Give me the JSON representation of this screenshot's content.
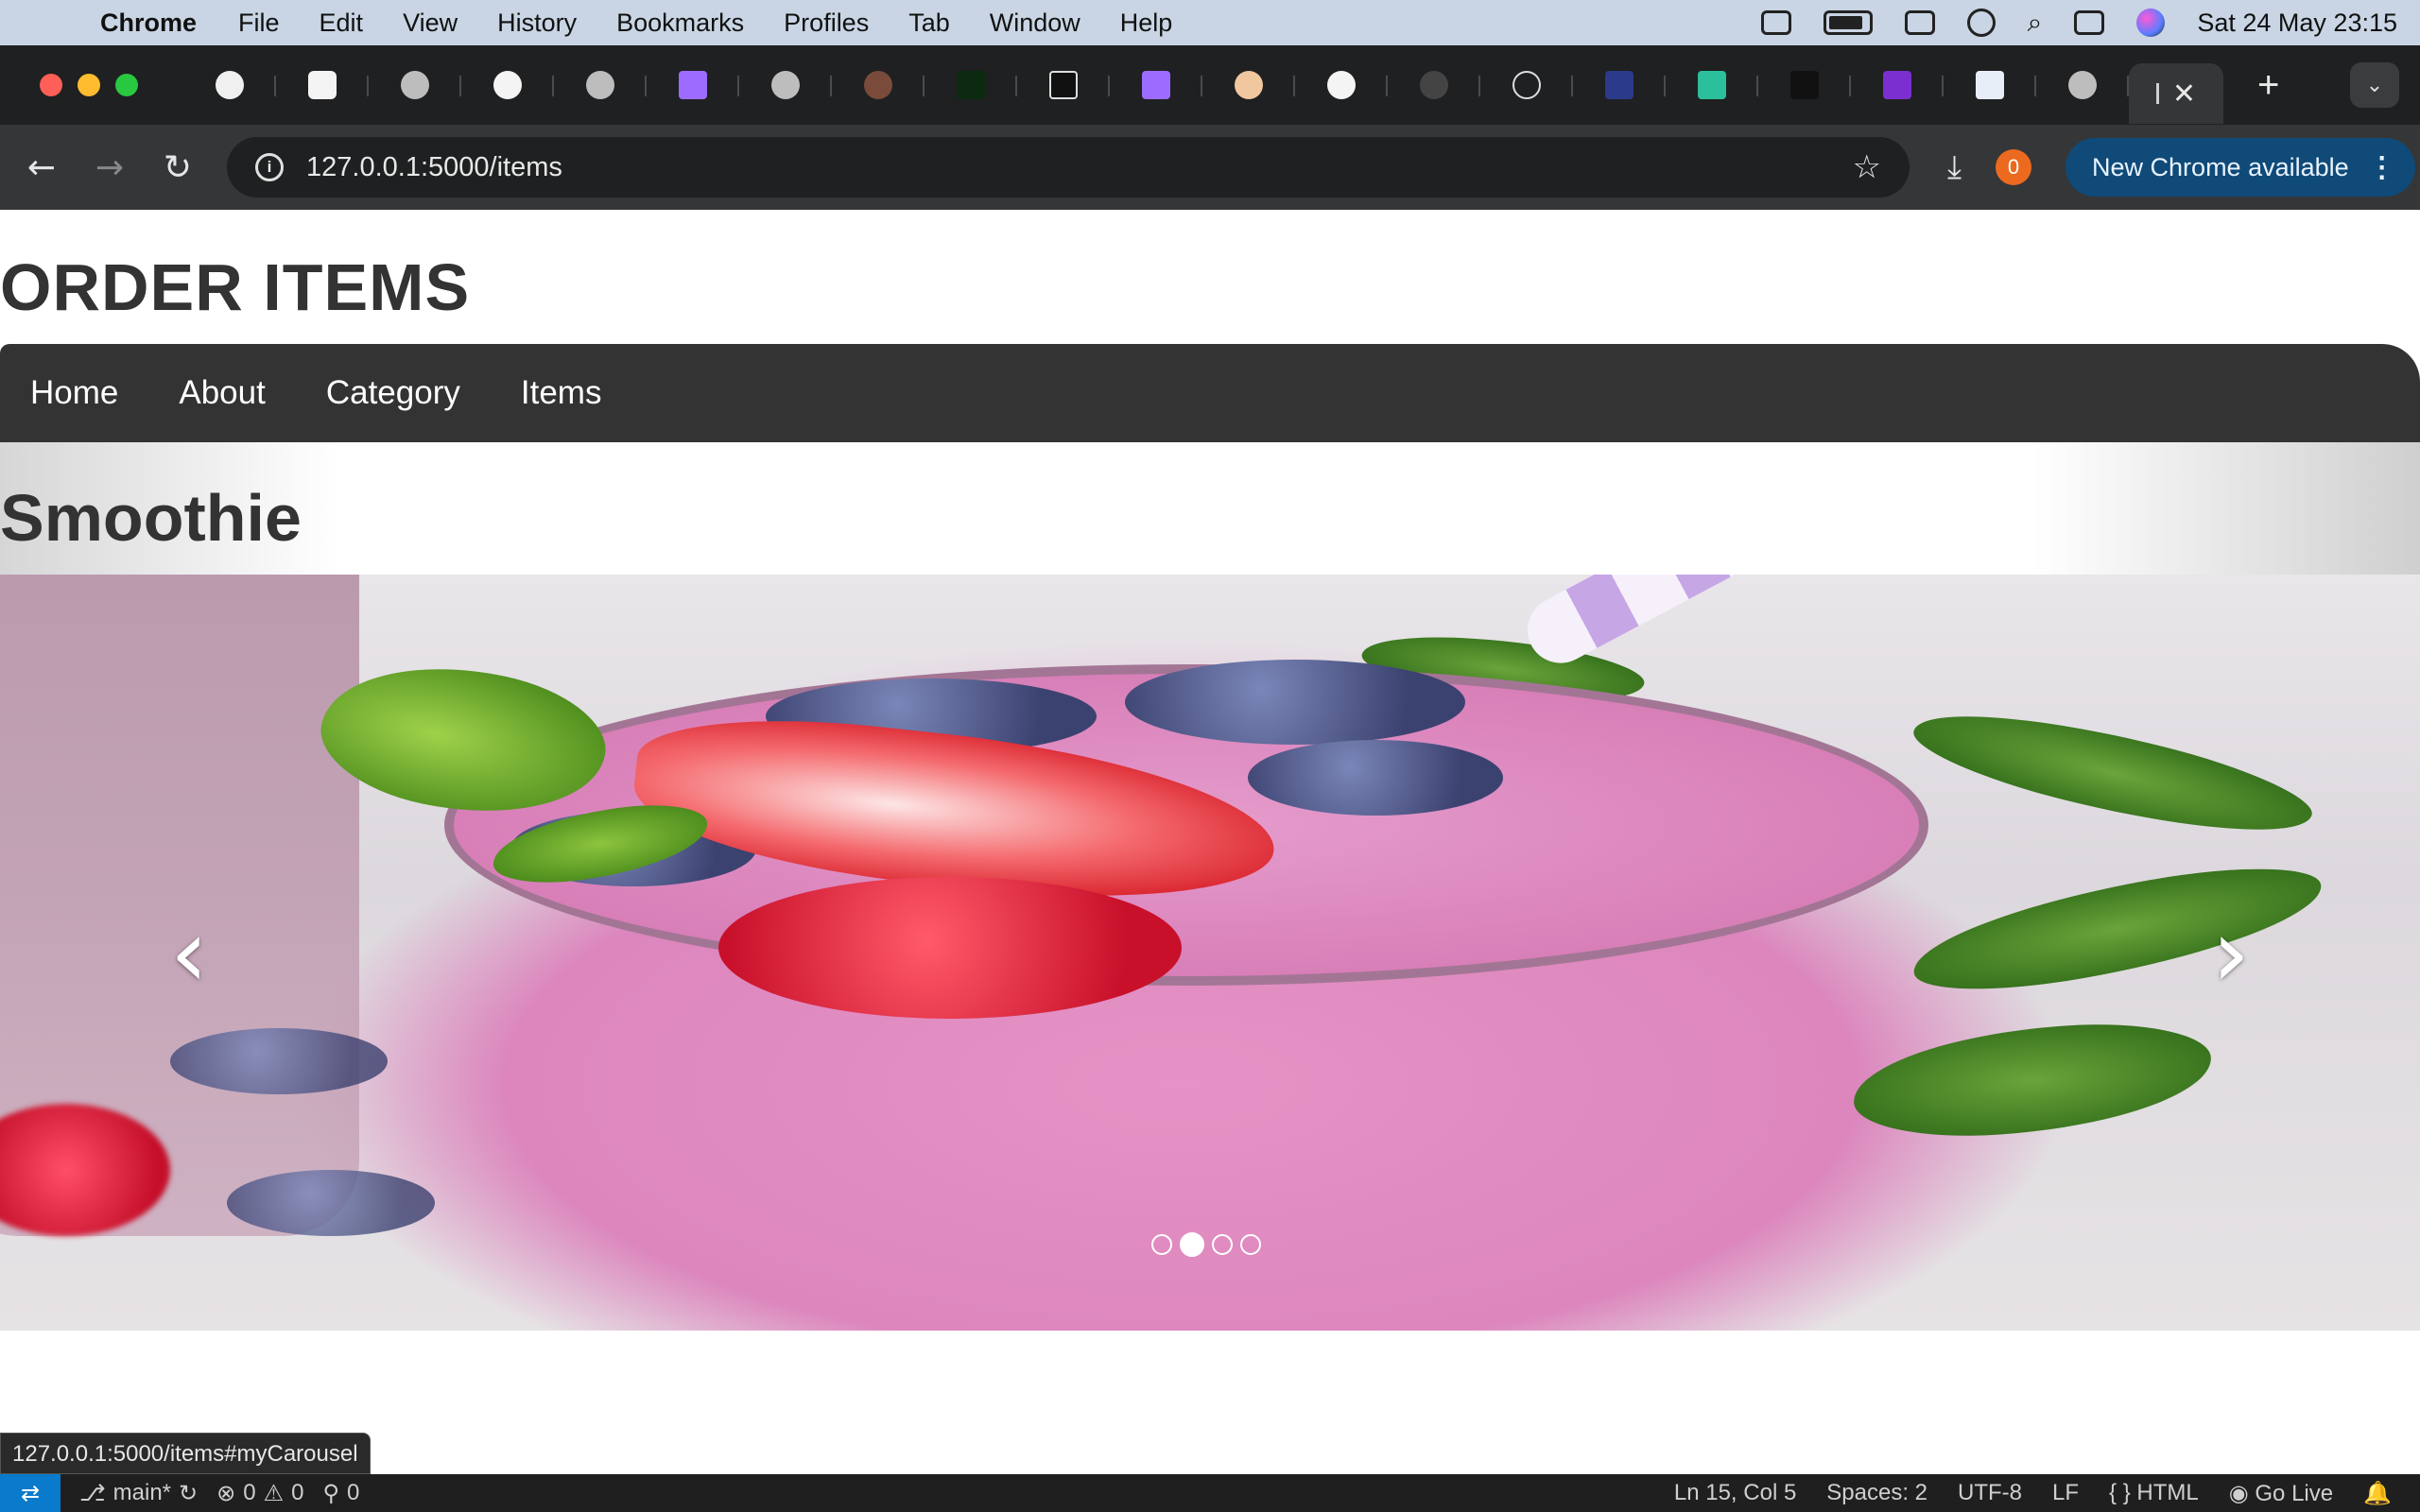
{
  "menubar": {
    "app_name": "Chrome",
    "items": [
      "File",
      "Edit",
      "View",
      "History",
      "Bookmarks",
      "Profiles",
      "Tab",
      "Window",
      "Help"
    ],
    "clock": "Sat 24 May  23:15"
  },
  "browser": {
    "url": "127.0.0.1:5000/items",
    "extension_badge": "0",
    "update_label": "New Chrome available",
    "tab_count_visible": 21
  },
  "site": {
    "title": "ORDER ITEMS",
    "nav": [
      "Home",
      "About",
      "Category",
      "Items"
    ]
  },
  "carousel": {
    "slide_title": "Smoothie",
    "prev_glyph": "‹",
    "next_glyph": "›",
    "indicator_count": 4,
    "active_indicator": 2
  },
  "status_url": "127.0.0.1:5000/items#myCarousel",
  "vscode_status": {
    "branch": "main*",
    "errors": "0",
    "warnings": "0",
    "ports": "0",
    "position": "Ln 15, Col 5",
    "spaces": "Spaces: 2",
    "encoding": "UTF-8",
    "eol": "LF",
    "language": "HTML",
    "go_live": "Go Live"
  },
  "colors": {
    "site_nav_bg": "#333333",
    "update_pill": "#0f4a78",
    "extension_badge": "#ec6a1f",
    "vscode_remote": "#0a7acc"
  }
}
